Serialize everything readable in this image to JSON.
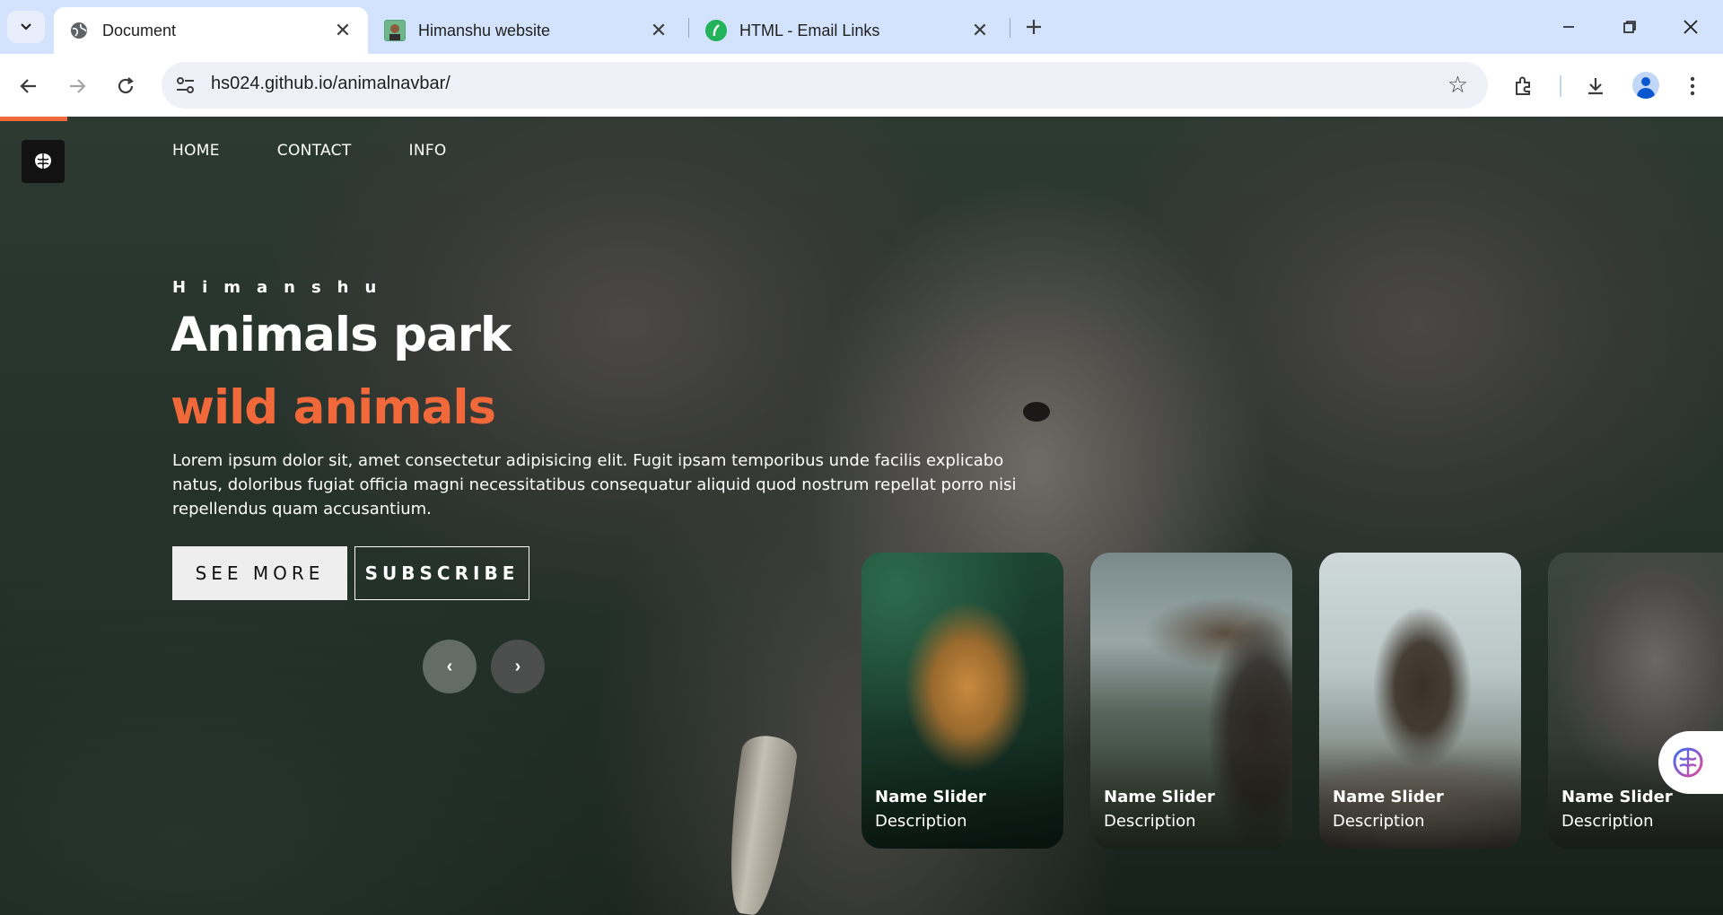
{
  "browser": {
    "tabs": [
      {
        "title": "Document",
        "active": true,
        "icon": "globe-icon"
      },
      {
        "title": "Himanshu website",
        "active": false,
        "icon": "avatar-favicon"
      },
      {
        "title": "HTML - Email Links",
        "active": false,
        "icon": "leaf-favicon"
      }
    ],
    "url": "hs024.github.io/animalnavbar/"
  },
  "page": {
    "nav": [
      "HOME",
      "CONTACT",
      "INFO"
    ],
    "hero": {
      "author": "Himanshu",
      "title": "Animals park",
      "subtitle": "wild animals",
      "description": "Lorem ipsum dolor sit, amet consectetur adipisicing elit. Fugit ipsam temporibus unde facilis explicabo natus, doloribus fugiat officia magni necessitatibus consequatur aliquid quod nostrum repellat porro nisi repellendus quam accusantium.",
      "see_more": "SEE MORE",
      "subscribe": "SUBSCRIBE"
    },
    "slider": {
      "prev": "‹",
      "next": "›",
      "cards": [
        {
          "name": "Name Slider",
          "desc": "Description",
          "animal": "leopard"
        },
        {
          "name": "Name Slider",
          "desc": "Description",
          "animal": "moose"
        },
        {
          "name": "Name Slider",
          "desc": "Description",
          "animal": "moose"
        },
        {
          "name": "Name Slider",
          "desc": "Description",
          "animal": "elephant"
        }
      ]
    }
  },
  "colors": {
    "accent": "#f1683a",
    "tab_bar": "#d3e3fd",
    "page_text": "#ffffff"
  }
}
